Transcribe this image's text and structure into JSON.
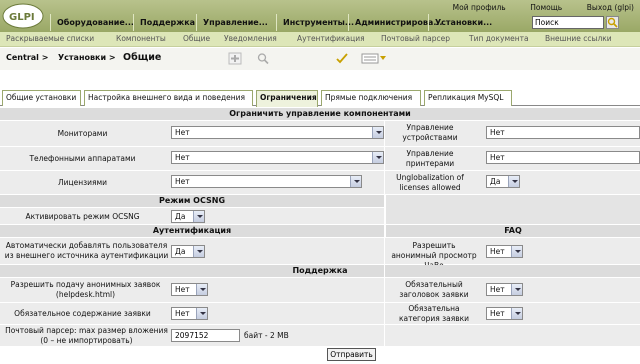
{
  "header": {
    "logo_text": "GLPI",
    "top_links": [
      "Мой профиль",
      "Помощь",
      "Выход (glpi)"
    ],
    "menu": [
      "Оборудование...",
      "Поддержка",
      "Управление...",
      "Инструменты...",
      "Администрирова...",
      "Установки..."
    ],
    "search_value": "Поиск"
  },
  "submenu": [
    "Раскрываемые списки",
    "Компоненты",
    "Общие",
    "Уведомления",
    "Аутентификация",
    "Почтовый парсер",
    "Тип документа",
    "Внешние ссылки"
  ],
  "breadcrumb": {
    "central": "Central >",
    "setup": "Установки >",
    "title": "Общие"
  },
  "tabs": [
    "Общие установки",
    "Настройка внешнего вида и поведения",
    "Ограничения",
    "Прямые подключения",
    "Репликация MySQL"
  ],
  "sections": {
    "limits": "Ограничить управление компонентами",
    "ocsng": "Режим OCSNG",
    "auth": "Аутентификация",
    "faq": "FAQ",
    "support": "Поддержка"
  },
  "fields": {
    "monitors": {
      "label": "Мониторами",
      "value": "Нет"
    },
    "devices": {
      "label": "Управление устройствами",
      "value": "Нет"
    },
    "phones": {
      "label": "Телефонными аппаратами",
      "value": "Нет"
    },
    "printers": {
      "label": "Управление принтерами",
      "value": "Нет"
    },
    "licenses": {
      "label": "Лицензиями",
      "value": "Нет"
    },
    "unglobalization": {
      "label": "Unglobalization of licenses allowed",
      "value": "Да"
    },
    "ocsng": {
      "label": "Активировать режим OCSNG",
      "value": "Да"
    },
    "auto_add": {
      "label": "Автоматически добавлять пользователя из внешнего источника аутентификации",
      "value": "Да"
    },
    "anon_faq": {
      "label": "Разрешить анонимный просмотр ЧаВо",
      "value": "Нет"
    },
    "anon_helpdesk": {
      "label": "Разрешить подачу анонимных заявок (helpdesk.html)",
      "value": "Нет"
    },
    "mandatory_title": {
      "label": "Обязательный заголовок заявки",
      "value": "Нет"
    },
    "mandatory_content": {
      "label": "Обязательное содержание заявки",
      "value": "Нет"
    },
    "mandatory_category": {
      "label": "Обязательна категория заявки",
      "value": "Нет"
    },
    "mail_max": {
      "label": "Почтовый парсер: max размер вложения (0 – не импортировать)",
      "value": "2097152",
      "unit": "байт - 2 MB"
    }
  },
  "submit_label": "Отправить",
  "colors": {
    "header": "#9aa866",
    "submenu": "#dde6b8",
    "section": "#dcdcdc",
    "row": "#ececec"
  }
}
